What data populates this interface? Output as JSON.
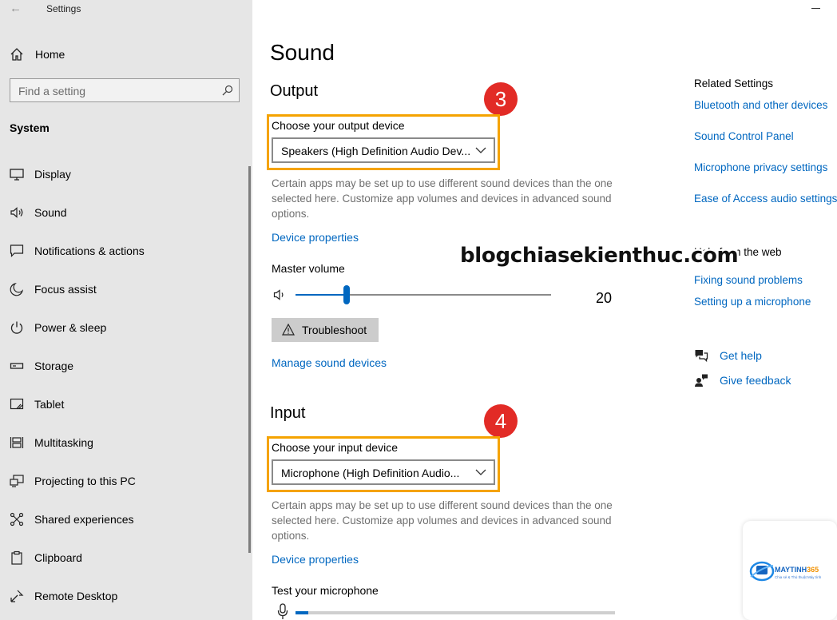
{
  "app": {
    "title": "Settings"
  },
  "sidebar": {
    "home": "Home",
    "search_placeholder": "Find a setting",
    "section": "System",
    "items": [
      {
        "label": "Display",
        "icon": "display-icon"
      },
      {
        "label": "Sound",
        "icon": "speaker-icon"
      },
      {
        "label": "Notifications & actions",
        "icon": "notifications-icon"
      },
      {
        "label": "Focus assist",
        "icon": "moon-icon"
      },
      {
        "label": "Power & sleep",
        "icon": "power-icon"
      },
      {
        "label": "Storage",
        "icon": "storage-icon"
      },
      {
        "label": "Tablet",
        "icon": "tablet-icon"
      },
      {
        "label": "Multitasking",
        "icon": "multitasking-icon"
      },
      {
        "label": "Projecting to this PC",
        "icon": "projecting-icon"
      },
      {
        "label": "Shared experiences",
        "icon": "shared-icon"
      },
      {
        "label": "Clipboard",
        "icon": "clipboard-icon"
      },
      {
        "label": "Remote Desktop",
        "icon": "remote-desktop-icon"
      }
    ]
  },
  "main": {
    "title": "Sound",
    "output": {
      "heading": "Output",
      "badge": "3",
      "device_label": "Choose your output device",
      "device_value": "Speakers (High Definition Audio Dev...",
      "description": "Certain apps may be set up to use different sound devices than the one selected here. Customize app volumes and devices in advanced sound options.",
      "device_properties": "Device properties",
      "master_volume_label": "Master volume",
      "volume_value": "20",
      "volume_fraction": 0.2,
      "troubleshoot": "Troubleshoot",
      "manage_devices": "Manage sound devices"
    },
    "input": {
      "heading": "Input",
      "badge": "4",
      "device_label": "Choose your input device",
      "device_value": "Microphone (High Definition Audio...",
      "description": "Certain apps may be set up to use different sound devices than the one selected here. Customize app volumes and devices in advanced sound options.",
      "device_properties": "Device properties",
      "test_label": "Test your microphone",
      "mic_level_fraction": 0.04
    }
  },
  "related": {
    "title": "Related Settings",
    "links": [
      "Bluetooth and other devices",
      "Sound Control Panel",
      "Microphone privacy settings",
      "Ease of Access audio settings"
    ],
    "web_title": "Help from the web",
    "web_links": [
      "Fixing sound problems",
      "Setting up a microphone"
    ],
    "get_help": "Get help",
    "give_feedback": "Give feedback"
  },
  "watermark": {
    "text": "blogchiasekienthuc.com"
  },
  "logo": {
    "name_a": "MAYTINH",
    "name_b": "365",
    "tagline": "Chia sẻ & Thủ thuật Máy tính"
  },
  "colors": {
    "accent": "#0067c0",
    "highlight_box": "#f5a300",
    "badge": "#e22b26",
    "sidebar_bg": "#e6e6e6"
  }
}
